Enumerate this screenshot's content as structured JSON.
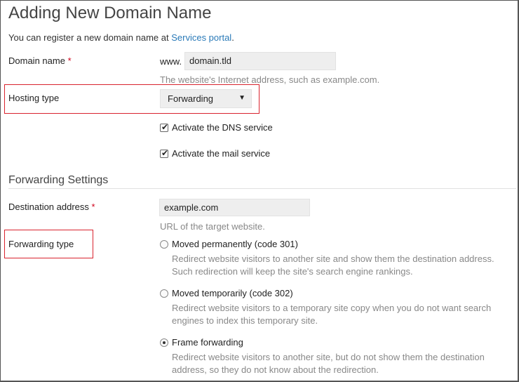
{
  "page": {
    "title": "Adding New Domain Name",
    "intro_text": "You can register a new domain name at ",
    "intro_link": "Services portal",
    "intro_end": "."
  },
  "domain": {
    "label": "Domain name",
    "required_mark": "*",
    "prefix": "www.",
    "value": "domain.tld",
    "hint": "The website's Internet address, such as example.com."
  },
  "hosting": {
    "label": "Hosting type",
    "selected": "Forwarding",
    "arrow": "▼"
  },
  "options": {
    "dns_label": "Activate the DNS service",
    "dns_checked": true,
    "mail_label": "Activate the mail service",
    "mail_checked": true,
    "check_glyph": "✔"
  },
  "forwarding": {
    "section_title": "Forwarding Settings",
    "dest_label": "Destination address",
    "required_mark": "*",
    "dest_value": "example.com",
    "dest_hint": "URL of the target website.",
    "type_label": "Forwarding type",
    "types": [
      {
        "label": "Moved permanently (code 301)",
        "desc1": "Redirect website visitors to another site and show them the destination address.",
        "desc2": "Such redirection will keep the site's search engine rankings.",
        "selected": false
      },
      {
        "label": "Moved temporarily (code 302)",
        "desc1": "Redirect website visitors to a temporary site copy when you do not want search",
        "desc2": "engines to index this temporary site.",
        "selected": false
      },
      {
        "label": "Frame forwarding",
        "desc1": "Redirect website visitors to another site, but do not show them the destination",
        "desc2": "address, so they do not know about the redirection.",
        "selected": true
      }
    ]
  },
  "colors": {
    "highlight_box": "#d9232e",
    "link": "#2a7ab8",
    "required": "#d0021b"
  }
}
